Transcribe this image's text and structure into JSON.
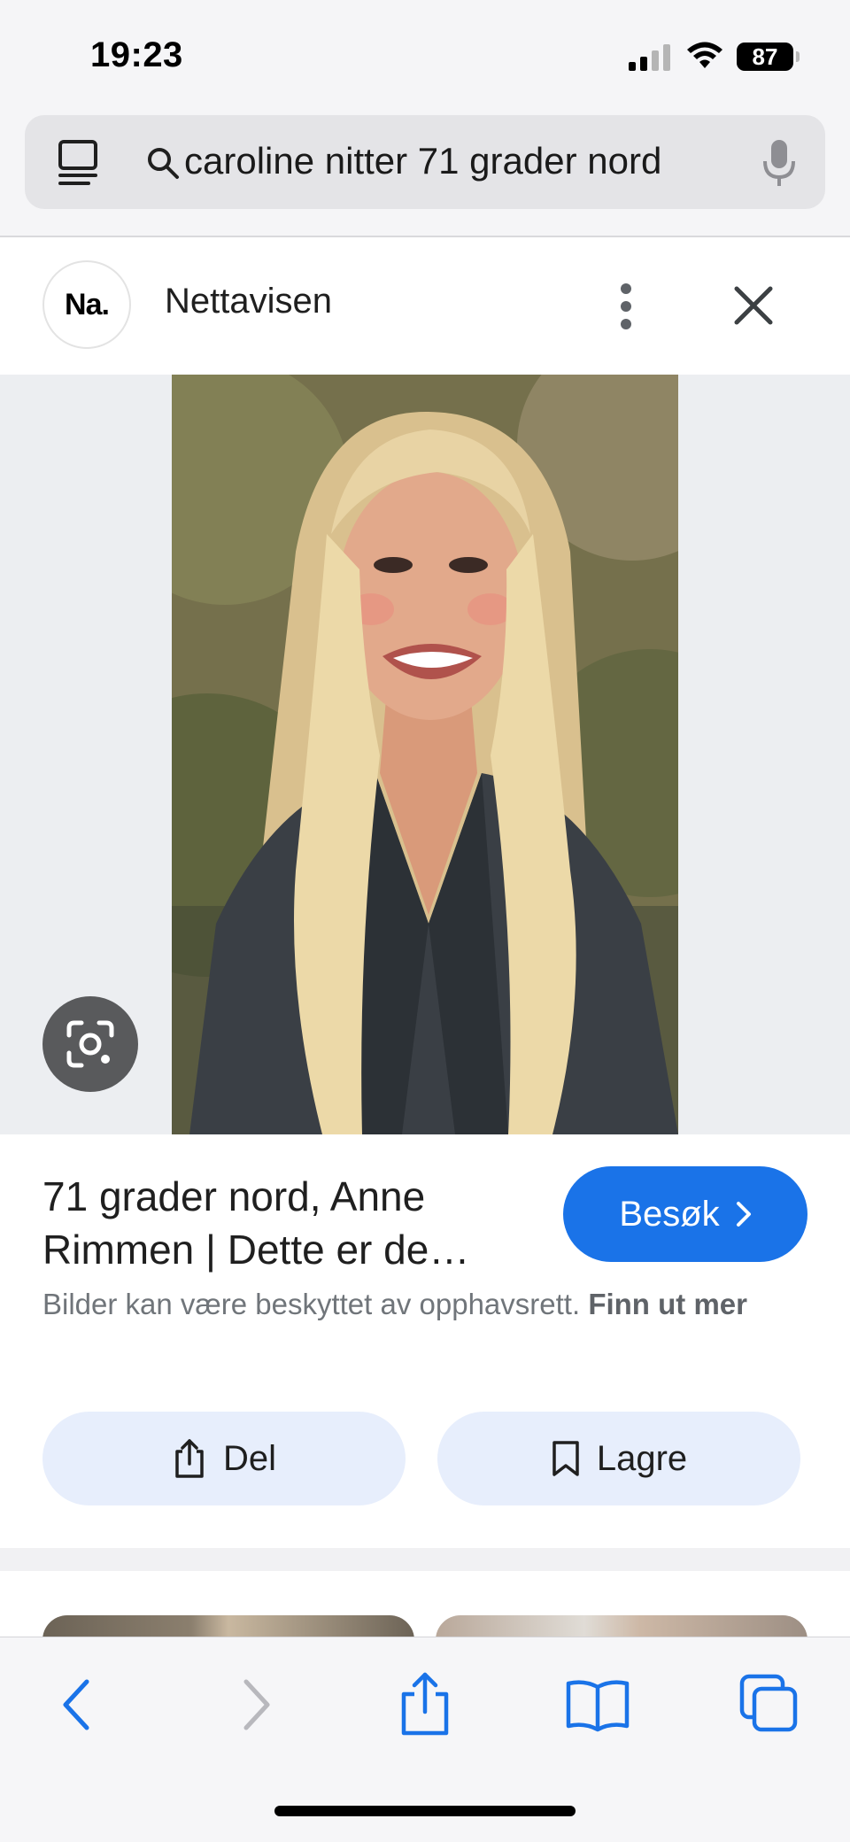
{
  "status_bar": {
    "time": "19:23",
    "battery": "87",
    "icons": [
      "signal-icon",
      "wifi-icon",
      "battery-icon"
    ]
  },
  "search": {
    "query": "caroline nitter 71 grader nord",
    "icons": [
      "tabs-icon",
      "search-icon",
      "microphone-icon"
    ]
  },
  "source": {
    "logo_text": "Na.",
    "name": "Nettavisen",
    "icons": [
      "more-vert-icon",
      "close-icon"
    ]
  },
  "image": {
    "description_icon": "google-lens-icon"
  },
  "result": {
    "title": "71 grader nord, Anne Rimmen | Dette er de…",
    "visit_label": "Besøk",
    "copyright_text": "Bilder kan være beskyttet av opphavsrett.",
    "copyright_link": "Finn ut mer",
    "share_label": "Del",
    "save_label": "Lagre"
  },
  "toolbar": {
    "buttons": [
      "back-icon",
      "forward-icon",
      "share-icon",
      "bookmarks-icon",
      "tabs-icon"
    ]
  },
  "colors": {
    "accent": "#1a73e8",
    "pill_bg": "#e7eefc",
    "muted_text": "#70757a"
  }
}
